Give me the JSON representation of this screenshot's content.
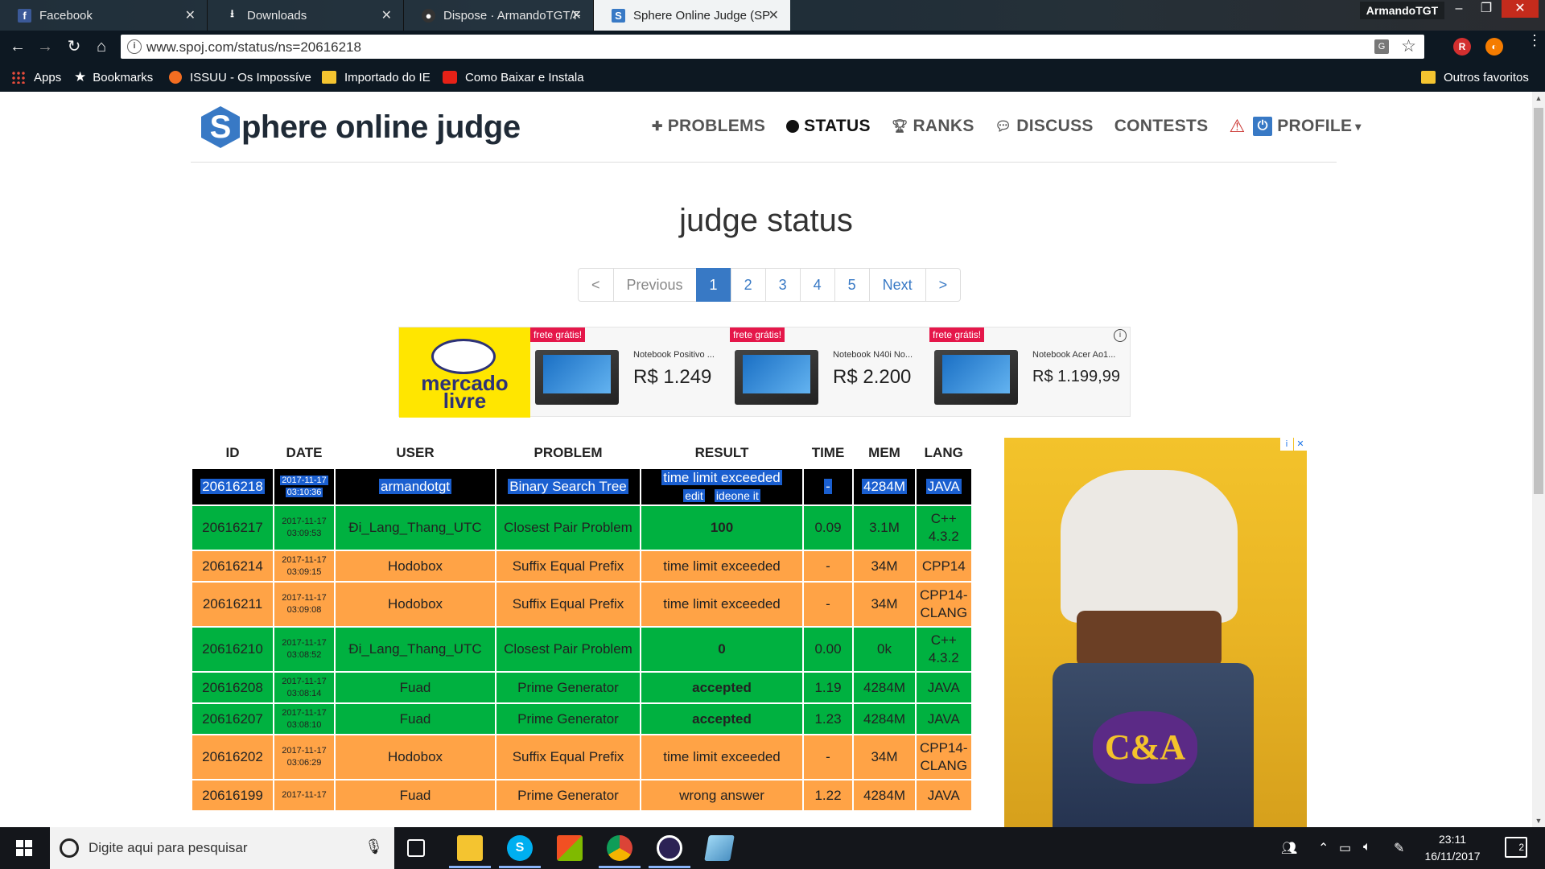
{
  "browser": {
    "tabs": [
      {
        "title": "Facebook",
        "icon": "facebook-icon"
      },
      {
        "title": "Downloads",
        "icon": "download-icon"
      },
      {
        "title": "Dispose · ArmandoTGT/F",
        "icon": "github-icon"
      },
      {
        "title": "Sphere Online Judge (SP",
        "icon": "spoj-icon"
      }
    ],
    "profile_name": "ArmandoTGT",
    "url": "www.spoj.com/status/ns=20616218",
    "bookmarks": [
      {
        "label": "Apps",
        "icon": "apps-grid-icon"
      },
      {
        "label": "Bookmarks",
        "icon": "star-icon"
      },
      {
        "label": "ISSUU - Os Impossíve",
        "icon": "issuu-icon"
      },
      {
        "label": "Importado do IE",
        "icon": "folder-icon"
      },
      {
        "label": "Como Baixar e Instala",
        "icon": "youtube-icon"
      }
    ],
    "other_bookmarks": "Outros favoritos"
  },
  "site": {
    "logo_letter": "S",
    "logo_text": "phere online judge",
    "nav": [
      {
        "label": "PROBLEMS",
        "icon": "puzzle-icon",
        "active": false
      },
      {
        "label": "STATUS",
        "icon": "circle-icon",
        "active": true
      },
      {
        "label": "RANKS",
        "icon": "trophy-icon",
        "active": false
      },
      {
        "label": "DISCUSS",
        "icon": "comments-icon",
        "active": false
      },
      {
        "label": "CONTESTS",
        "icon": "",
        "active": false
      }
    ],
    "profile_label": "PROFILE",
    "profile_caret": "▾"
  },
  "page_title": "judge status",
  "pagination": {
    "first": "<",
    "previous": "Previous",
    "pages": [
      "1",
      "2",
      "3",
      "4",
      "5"
    ],
    "current": "1",
    "next": "Next",
    "last": ">"
  },
  "banner_ad": {
    "brand_line1": "mercado",
    "brand_line2": "livre",
    "items": [
      {
        "badge": "frete grátis!",
        "name": "Notebook Positivo ...",
        "price": "R$ 1.249"
      },
      {
        "badge": "frete grátis!",
        "name": "Notebook N40i No...",
        "price": "R$ 2.200"
      },
      {
        "badge": "frete grátis!",
        "name": "Notebook Acer Ao1...",
        "price": "R$ 1.199,99"
      }
    ],
    "info_glyph": "i"
  },
  "side_ad": {
    "brand": "C&A",
    "info_glyph": "i",
    "close_glyph": "✕"
  },
  "status_table": {
    "headers": [
      "ID",
      "DATE",
      "USER",
      "PROBLEM",
      "RESULT",
      "TIME",
      "MEM",
      "LANG"
    ],
    "rows": [
      {
        "id": "20616218",
        "date1": "2017-11-17",
        "date2": "03:10:36",
        "user": "armandotgt",
        "problem": "Binary Search Tree",
        "result": "time limit exceeded",
        "result_links": [
          "edit",
          "ideone it"
        ],
        "time": "-",
        "mem": "4284M",
        "lang1": "JAVA",
        "lang2": "",
        "style": "selected"
      },
      {
        "id": "20616217",
        "date1": "2017-11-17",
        "date2": "03:09:53",
        "user": "Đi_Lang_Thang_UTC",
        "problem": "Closest Pair Problem",
        "result": "100",
        "time": "0.09",
        "mem": "3.1M",
        "lang1": "C++",
        "lang2": "4.3.2",
        "style": "green"
      },
      {
        "id": "20616214",
        "date1": "2017-11-17",
        "date2": "03:09:15",
        "user": "Hodobox",
        "problem": "Suffix Equal Prefix",
        "result": "time limit exceeded",
        "time": "-",
        "mem": "34M",
        "lang1": "CPP14",
        "lang2": "",
        "style": "orange"
      },
      {
        "id": "20616211",
        "date1": "2017-11-17",
        "date2": "03:09:08",
        "user": "Hodobox",
        "problem": "Suffix Equal Prefix",
        "result": "time limit exceeded",
        "time": "-",
        "mem": "34M",
        "lang1": "CPP14-",
        "lang2": "CLANG",
        "style": "orange"
      },
      {
        "id": "20616210",
        "date1": "2017-11-17",
        "date2": "03:08:52",
        "user": "Đi_Lang_Thang_UTC",
        "problem": "Closest Pair Problem",
        "result": "0",
        "time": "0.00",
        "mem": "0k",
        "lang1": "C++",
        "lang2": "4.3.2",
        "style": "green"
      },
      {
        "id": "20616208",
        "date1": "2017-11-17",
        "date2": "03:08:14",
        "user": "Fuad",
        "problem": "Prime Generator",
        "result": "accepted",
        "time": "1.19",
        "mem": "4284M",
        "lang1": "JAVA",
        "lang2": "",
        "style": "green"
      },
      {
        "id": "20616207",
        "date1": "2017-11-17",
        "date2": "03:08:10",
        "user": "Fuad",
        "problem": "Prime Generator",
        "result": "accepted",
        "time": "1.23",
        "mem": "4284M",
        "lang1": "JAVA",
        "lang2": "",
        "style": "green"
      },
      {
        "id": "20616202",
        "date1": "2017-11-17",
        "date2": "03:06:29",
        "user": "Hodobox",
        "problem": "Suffix Equal Prefix",
        "result": "time limit exceeded",
        "time": "-",
        "mem": "34M",
        "lang1": "CPP14-",
        "lang2": "CLANG",
        "style": "orange"
      },
      {
        "id": "20616199",
        "date1": "2017-11-17",
        "date2": "",
        "user": "Fuad",
        "problem": "Prime Generator",
        "result": "wrong answer",
        "time": "1.22",
        "mem": "4284M",
        "lang1": "JAVA",
        "lang2": "",
        "style": "orange"
      }
    ]
  },
  "colors": {
    "spoj_blue": "#3879c5",
    "accepted_green": "#00b140",
    "tle_orange": "#ffa346",
    "selection_blue": "#1a5fd0"
  },
  "taskbar": {
    "search_placeholder": "Digite aqui para pesquisar",
    "apps": [
      "task-view-icon",
      "file-explorer-icon",
      "skype-icon",
      "store-icon",
      "chrome-icon",
      "eclipse-icon",
      "app-icon"
    ],
    "time": "23:11",
    "date": "16/11/2017",
    "notifications": "2"
  }
}
